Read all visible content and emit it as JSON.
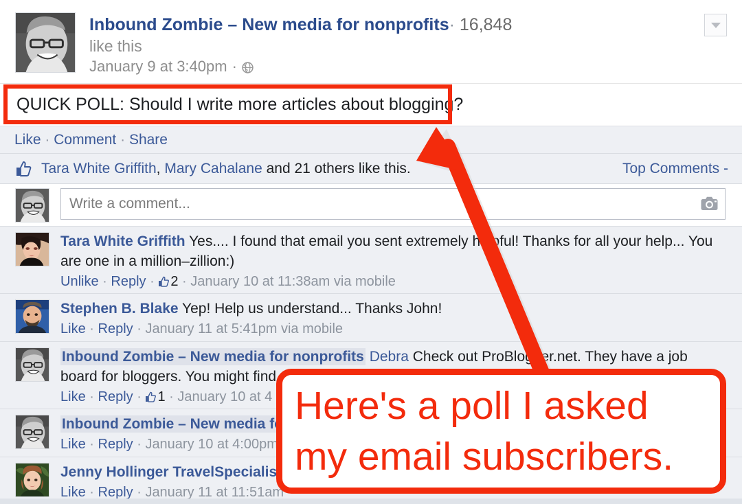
{
  "post": {
    "avatar_name": "page-profile-photo",
    "page_name": "Inbound Zombie – New media for nonprofits",
    "separator": "·",
    "like_count": "16,848",
    "like_this_text": "like this",
    "timestamp": "January 9 at 3:40pm",
    "privacy_icon": "globe-icon",
    "menu_icon": "chevron-down-icon",
    "message": "QUICK POLL: Should I write more articles about blogging?"
  },
  "actions": {
    "like": "Like",
    "comment": "Comment",
    "share": "Share",
    "separator": "·"
  },
  "likers": {
    "thumb_icon": "thumbs-up-icon",
    "name_1": "Tara White Griffith",
    "comma": ", ",
    "name_2": "Mary Cahalane",
    "and_text": " and ",
    "others_text": "21 others",
    "suffix": " like this.",
    "sort_label": "Top Comments",
    "sort_caret": "-"
  },
  "composer": {
    "placeholder": "Write a comment...",
    "value": "",
    "camera_icon": "camera-icon"
  },
  "comments": [
    {
      "author": "Tara White Griffith",
      "author_highlight": false,
      "mention": "",
      "text": " Yes.... I found that email you sent extremely helpful! Thanks for all your help... You are one in a million–zillion:)",
      "like_action": "Unlike",
      "reply_action": "Reply",
      "like_count": "2",
      "timestamp": "January 10 at 11:38am via mobile",
      "separator": "·"
    },
    {
      "author": "Stephen B. Blake",
      "author_highlight": false,
      "mention": "",
      "text": " Yep! Help us understand... Thanks John!",
      "like_action": "Like",
      "reply_action": "Reply",
      "like_count": "",
      "timestamp": "January 11 at 5:41pm via mobile",
      "separator": "·"
    },
    {
      "author": "Inbound Zombie – New media for nonprofits",
      "author_highlight": true,
      "mention": "Debra",
      "text": " Check out ProBlogger.net. They have a job board for bloggers. You might find",
      "like_action": "Like",
      "reply_action": "Reply",
      "like_count": "1",
      "timestamp": "January 10 at 4",
      "separator": "·"
    },
    {
      "author": "Inbound Zombie – New media fo",
      "author_highlight": true,
      "mention": "",
      "text": "",
      "like_action": "Like",
      "reply_action": "Reply",
      "like_count": "",
      "timestamp": "January 10 at 4:00pm",
      "separator": "·"
    },
    {
      "author": "Jenny Hollinger TravelSpecialist",
      "author_highlight": false,
      "mention": "",
      "text": "",
      "like_action": "Like",
      "reply_action": "Reply",
      "like_count": "",
      "timestamp": "January 11 at 11:51am",
      "separator": "·"
    }
  ],
  "annotation": {
    "callout_line_1": "Here's a poll I asked",
    "callout_line_2": "my email subscribers.",
    "color": "#f32b0c",
    "arrow_name": "red-annotation-arrow",
    "highlight_box_name": "red-highlight-box"
  },
  "colors": {
    "fb_blue": "#3b5998",
    "annotation_red": "#f32b0c",
    "comment_bg": "#eef0f4",
    "white": "#ffffff",
    "muted_gray": "#8d949e"
  }
}
